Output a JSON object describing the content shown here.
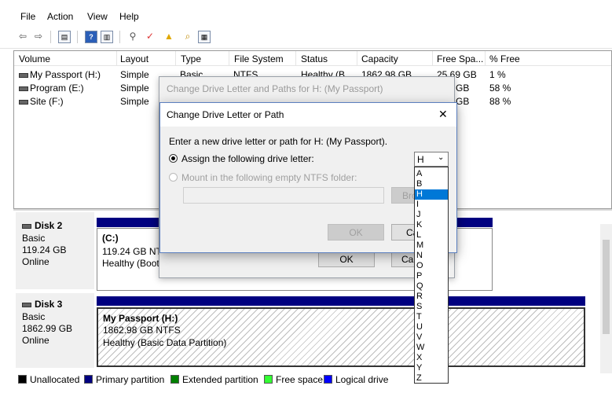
{
  "menu": [
    "File",
    "Action",
    "View",
    "Help"
  ],
  "toolbar": {
    "icons": [
      "back-arrow",
      "forward-arrow",
      "list-view",
      "help",
      "properties",
      "connect",
      "check",
      "folder-up",
      "folder-search",
      "details"
    ],
    "glyphs": [
      "⇦",
      "⇨",
      "▤",
      "?",
      "▥",
      "⚲",
      "✓",
      "▲",
      "⌕",
      "▦"
    ]
  },
  "volumes": {
    "headers": [
      "Volume",
      "Layout",
      "Type",
      "File System",
      "Status",
      "Capacity",
      "Free Spa...",
      "% Free"
    ],
    "rows": [
      {
        "name": "My Passport (H:)",
        "layout": "Simple",
        "type": "Basic",
        "fs": "NTFS",
        "status": "Healthy (B...",
        "capacity": "1862.98 GB",
        "free": "25.69 GB",
        "pct": "1 %"
      },
      {
        "name": "Program (E:)",
        "layout": "Simple",
        "type": "",
        "fs": "",
        "status": "",
        "capacity": "",
        "free": "GB",
        "pct": "58 %"
      },
      {
        "name": "Site (F:)",
        "layout": "Simple",
        "type": "",
        "fs": "",
        "status": "",
        "capacity": "",
        "free": "GB",
        "pct": "88 %"
      }
    ]
  },
  "disks": [
    {
      "name": "Disk 2",
      "kind": "Basic",
      "size": "119.24 GB",
      "state": "Online",
      "partition": {
        "title": "(C:)",
        "size": "119.24 GB NTF",
        "status": "Healthy (Boot"
      }
    },
    {
      "name": "Disk 3",
      "kind": "Basic",
      "size": "1862.99 GB",
      "state": "Online",
      "partition": {
        "title": "My Passport  (H:)",
        "size": "1862.98 GB NTFS",
        "status": "Healthy (Basic Data Partition)"
      }
    }
  ],
  "background_dialog": {
    "title": "Change Drive Letter and Paths for H: (My Passport)",
    "ok": "OK",
    "cancel": "Ca"
  },
  "dialog": {
    "title": "Change Drive Letter or Path",
    "close": "✕",
    "instruction": "Enter a new drive letter or path for H: (My Passport).",
    "assign_label": "Assign the following drive letter:",
    "mount_label": "Mount in the following empty NTFS folder:",
    "browse": "Bro",
    "ok": "OK",
    "cancel": "Ca",
    "selected_letter": "H",
    "letters": [
      "A",
      "B",
      "H",
      "I",
      "J",
      "K",
      "L",
      "M",
      "N",
      "O",
      "P",
      "Q",
      "R",
      "S",
      "T",
      "U",
      "V",
      "W",
      "X",
      "Y",
      "Z"
    ]
  },
  "legend": [
    {
      "label": "Unallocated",
      "color": "#000000"
    },
    {
      "label": "Primary partition",
      "color": "#000080"
    },
    {
      "label": "Extended partition",
      "color": "#008000"
    },
    {
      "label": "Free space",
      "color": "#33ff33"
    },
    {
      "label": "Logical drive",
      "color": "#0000ff"
    }
  ]
}
